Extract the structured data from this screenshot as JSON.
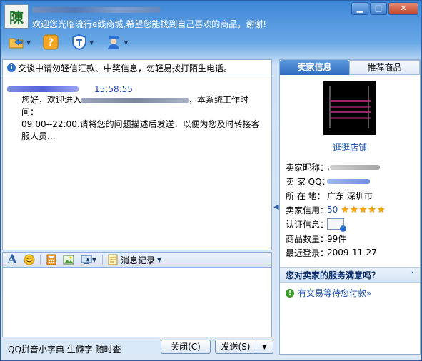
{
  "title": {
    "avatar_char": "陳",
    "subtitle": "欢迎您光临流行e线商城,希望您能找到自己喜欢的商品，谢谢!"
  },
  "window_controls": {
    "minimize": "▁",
    "maximize": "□",
    "close": "✕"
  },
  "toolbar": {
    "items": [
      {
        "icon": "folder-send-icon"
      },
      {
        "icon": "help-icon"
      },
      {
        "icon": "shield-icon"
      },
      {
        "icon": "police-icon"
      }
    ]
  },
  "chat": {
    "notice": "交谈中请勿轻信汇款、中奖信息，勿轻易拨打陌生电话。",
    "message_time": "15:58:55",
    "message_prefix": "您好，欢迎进入",
    "message_suffix": "，本系统工作时间：",
    "message_rest": "09:00--22:00.请将您的问题描述后发送，以便为您及时转接客服人员..."
  },
  "input_toolbar": {
    "history_label": "消息记录"
  },
  "bottom": {
    "dictionary_link": "QQ拼音小字典 生僻字 随时查",
    "close_button": "关闭(C)",
    "send_button": "发送(S)",
    "send_dropdown": "▼"
  },
  "right_panel": {
    "tabs": [
      {
        "label": "卖家信息",
        "active": true
      },
      {
        "label": "推荐商品",
        "active": false
      }
    ],
    "shop_link": "逛逛店铺",
    "fields": {
      "nickname_label": "卖家昵称：",
      "nickname_value": ",",
      "qq_label": "卖 家 QQ：",
      "location_label": "所 在 地：",
      "location_value": "广东 深圳市",
      "credit_label": "卖家信用：",
      "credit_value": "50",
      "stars": 5,
      "cert_label": "认证信息：",
      "count_label": "商品数量：",
      "count_value": "99件",
      "last_login_label": "最近登录：",
      "last_login_value": "2009-11-27"
    },
    "service_question": "您对卖家的服务满意吗？",
    "pending_payment": "有交易等待您付款»"
  },
  "colors": {
    "titlebar": "#3d86d6",
    "accent_blue": "#1a4ea8",
    "star": "#f0a500"
  }
}
